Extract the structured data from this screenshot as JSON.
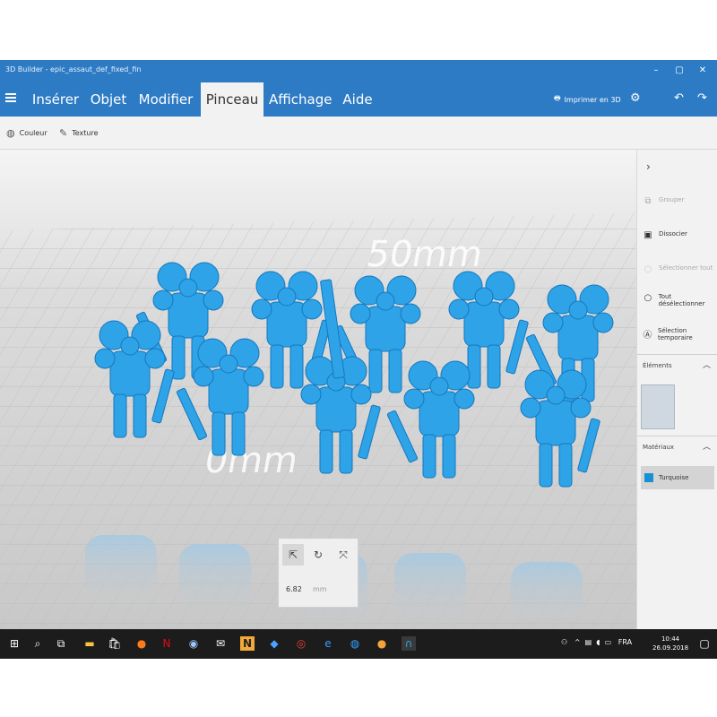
{
  "window": {
    "title": "3D Builder - epic_assaut_def_fixed_fin",
    "minimize_glyph": "–",
    "maximize_glyph": "▢",
    "close_glyph": "✕"
  },
  "menu": {
    "tabs": [
      {
        "label": "Insérer"
      },
      {
        "label": "Objet"
      },
      {
        "label": "Modifier"
      },
      {
        "label": "Pinceau"
      },
      {
        "label": "Affichage"
      },
      {
        "label": "Aide"
      }
    ],
    "active_tab": "Pinceau",
    "print_label": "Imprimer en 3D"
  },
  "toolbar": {
    "color_label": "Couleur",
    "texture_label": "Texture"
  },
  "viewport": {
    "scale_label_top": "50mm",
    "scale_label_bottom": "0mm",
    "model_color": "#2fa3e8",
    "model_dark": "#1577bd"
  },
  "right_panel": {
    "group_label": "Grouper",
    "ungroup_label": "Dissocier",
    "select_all_label": "Sélectionner tout",
    "deselect_all_label": "Tout désélectionner",
    "temp_select_label": "Sélection temporaire",
    "elements_header": "Éléments",
    "materials_header": "Matériaux",
    "material_name": "Turquoise",
    "material_color": "#1a8fd6"
  },
  "transform": {
    "value": "6.82",
    "unit": "mm"
  },
  "taskbar": {
    "language": "FRA",
    "time": "10:44",
    "date": "26.09.2018"
  }
}
